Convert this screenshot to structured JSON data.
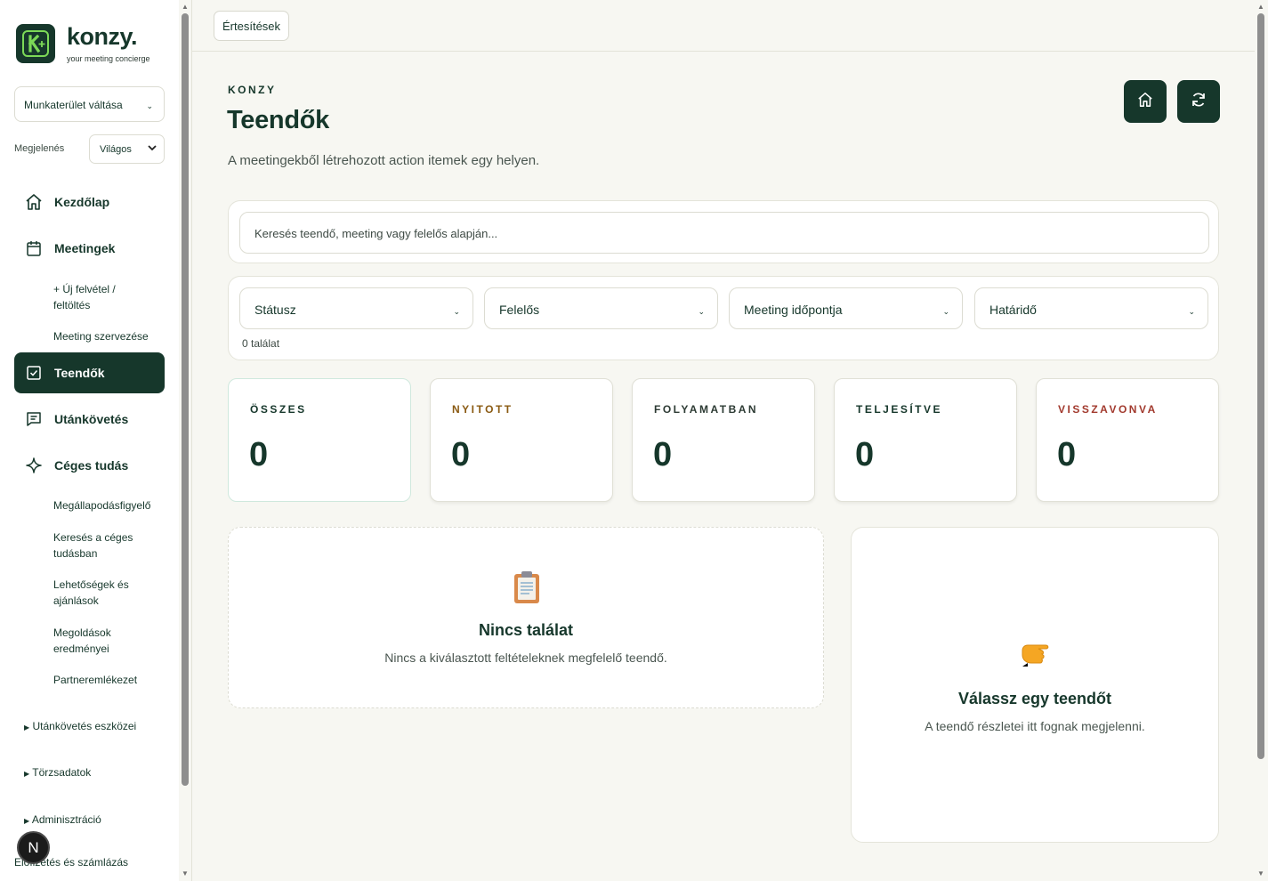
{
  "sidebar": {
    "logo_name": "konzy.",
    "logo_tagline": "your meeting concierge",
    "workspace_select": "Munkaterület váltása",
    "appearance_label": "Megjelenés",
    "appearance_value": "Világos",
    "nav": {
      "home": "Kezdőlap",
      "meetings": "Meetingek",
      "new_recording": "+ Új felvétel / feltöltés",
      "organize": "Meeting szervezése",
      "todos": "Teendők",
      "followup": "Utánkövetés",
      "knowledge": "Céges tudás",
      "agreement": "Megállapodásfigyelő",
      "search_knowledge": "Keresés a céges tudásban",
      "opportunities": "Lehetőségek és ajánlások",
      "solutions": "Megoldások eredményei",
      "partner_memory": "Partneremlékezet"
    },
    "groups": {
      "followup_tools": "Utánkövetés eszközei",
      "master_data": "Törzsadatok",
      "admin": "Adminisztráció",
      "billing": "Előfizetés és számlázás"
    },
    "badge": "N"
  },
  "topbar": {
    "notifications": "Értesítések"
  },
  "header": {
    "eyebrow": "KONZY",
    "title": "Teendők",
    "subtitle": "A meetingekből létrehozott action itemek egy helyen."
  },
  "search": {
    "placeholder": "Keresés teendő, meeting vagy felelős alapján..."
  },
  "filters": {
    "status": "Státusz",
    "owner": "Felelős",
    "meeting_date": "Meeting időpontja",
    "deadline": "Határidő",
    "result_count": "0 találat"
  },
  "stats": [
    {
      "label": "ÖSSZES",
      "value": "0",
      "color": "#16372b"
    },
    {
      "label": "NYITOTT",
      "value": "0",
      "color": "#8a5a12"
    },
    {
      "label": "FOLYAMATBAN",
      "value": "0",
      "color": "#2d3b34"
    },
    {
      "label": "TELJESÍTVE",
      "value": "0",
      "color": "#16372b"
    },
    {
      "label": "VISSZAVONVA",
      "value": "0",
      "color": "#a23a2e"
    }
  ],
  "empty": {
    "title": "Nincs találat",
    "desc": "Nincs a kiválasztott feltételeknek megfelelő teendő."
  },
  "detail": {
    "title": "Válassz egy teendőt",
    "desc": "A teendő részletei itt fognak megjelenni."
  },
  "colors": {
    "brand": "#16372b",
    "accent": "#7cd957",
    "background": "#f7f7f2"
  },
  "icons": [
    "home-icon",
    "calendar-icon",
    "checkbox-icon",
    "chat-icon",
    "sparkle-icon",
    "refresh-icon",
    "clipboard-icon",
    "pointing-hand-icon"
  ]
}
